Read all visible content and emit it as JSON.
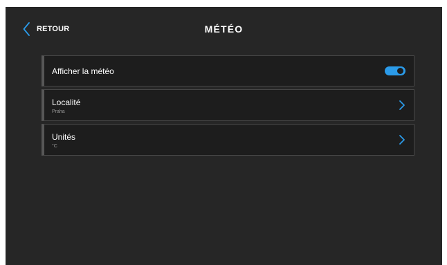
{
  "header": {
    "back_label": "RETOUR",
    "title": "MÉTÉO"
  },
  "settings": {
    "weather": {
      "label": "Afficher la météo",
      "enabled": true
    },
    "location": {
      "label": "Localité",
      "value": "Praha"
    },
    "units": {
      "label": "Unités",
      "value": "°C"
    }
  },
  "colors": {
    "background": "#262626",
    "row_background": "#1d1d1d",
    "accent": "#2b9be9",
    "text": "#ffffff",
    "subtext": "#9a9a9a"
  },
  "icons": {
    "back": "chevron-left-icon",
    "row_arrow": "chevron-right-icon"
  }
}
